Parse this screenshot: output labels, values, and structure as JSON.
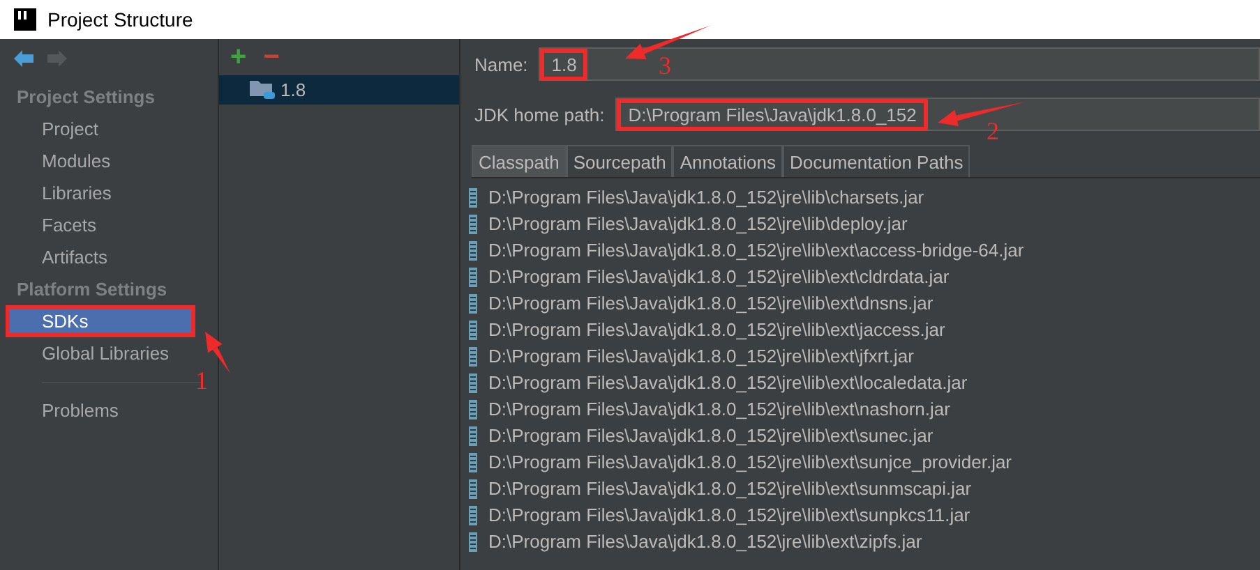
{
  "window": {
    "title": "Project Structure"
  },
  "sidebar": {
    "nav": [
      {
        "kind": "back",
        "disabled": false
      },
      {
        "kind": "forward",
        "disabled": true
      }
    ],
    "groups": [
      {
        "title": "Project Settings",
        "items": [
          {
            "label": "Project",
            "selected": false,
            "annotated": false
          },
          {
            "label": "Modules",
            "selected": false,
            "annotated": false
          },
          {
            "label": "Libraries",
            "selected": false,
            "annotated": false
          },
          {
            "label": "Facets",
            "selected": false,
            "annotated": false
          },
          {
            "label": "Artifacts",
            "selected": false,
            "annotated": false
          }
        ]
      },
      {
        "title": "Platform Settings",
        "items": [
          {
            "label": "SDKs",
            "selected": true,
            "annotated": true
          },
          {
            "label": "Global Libraries",
            "selected": false,
            "annotated": false
          }
        ]
      }
    ],
    "footer_items": [
      {
        "label": "Problems",
        "selected": false
      }
    ]
  },
  "sdk_tree": {
    "toolbar": [
      {
        "kind": "add",
        "label": "+"
      },
      {
        "kind": "remove",
        "label": "−"
      }
    ],
    "items": [
      {
        "label": "1.8",
        "selected": true
      }
    ]
  },
  "details": {
    "name_label": "Name:",
    "name_value": "1.8",
    "name_annotated": true,
    "home_label": "JDK home path:",
    "home_value": "D:\\Program Files\\Java\\jdk1.8.0_152",
    "home_annotated": true,
    "tabs": [
      {
        "label": "Classpath",
        "selected": true
      },
      {
        "label": "Sourcepath",
        "selected": false
      },
      {
        "label": "Annotations",
        "selected": false
      },
      {
        "label": "Documentation Paths",
        "selected": false
      }
    ],
    "classpath": [
      "D:\\Program Files\\Java\\jdk1.8.0_152\\jre\\lib\\charsets.jar",
      "D:\\Program Files\\Java\\jdk1.8.0_152\\jre\\lib\\deploy.jar",
      "D:\\Program Files\\Java\\jdk1.8.0_152\\jre\\lib\\ext\\access-bridge-64.jar",
      "D:\\Program Files\\Java\\jdk1.8.0_152\\jre\\lib\\ext\\cldrdata.jar",
      "D:\\Program Files\\Java\\jdk1.8.0_152\\jre\\lib\\ext\\dnsns.jar",
      "D:\\Program Files\\Java\\jdk1.8.0_152\\jre\\lib\\ext\\jaccess.jar",
      "D:\\Program Files\\Java\\jdk1.8.0_152\\jre\\lib\\ext\\jfxrt.jar",
      "D:\\Program Files\\Java\\jdk1.8.0_152\\jre\\lib\\ext\\localedata.jar",
      "D:\\Program Files\\Java\\jdk1.8.0_152\\jre\\lib\\ext\\nashorn.jar",
      "D:\\Program Files\\Java\\jdk1.8.0_152\\jre\\lib\\ext\\sunec.jar",
      "D:\\Program Files\\Java\\jdk1.8.0_152\\jre\\lib\\ext\\sunjce_provider.jar",
      "D:\\Program Files\\Java\\jdk1.8.0_152\\jre\\lib\\ext\\sunmscapi.jar",
      "D:\\Program Files\\Java\\jdk1.8.0_152\\jre\\lib\\ext\\sunpkcs11.jar",
      "D:\\Program Files\\Java\\jdk1.8.0_152\\jre\\lib\\ext\\zipfs.jar"
    ]
  },
  "annotation_marks": [
    {
      "number": "1"
    },
    {
      "number": "2"
    },
    {
      "number": "3"
    }
  ]
}
